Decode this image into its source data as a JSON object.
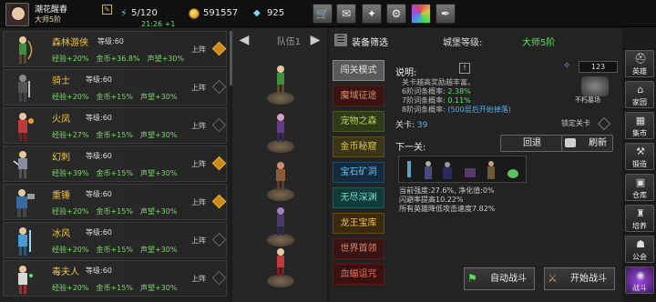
{
  "player": {
    "name": "潮花醒春",
    "rank": "大师5阶"
  },
  "resources": {
    "energy": "5/120",
    "energy_rate": "21:26 +1",
    "gold": "591557",
    "gems": "925"
  },
  "top_buttons": [
    "shop-icon",
    "mail-icon",
    "gamepad-icon",
    "settings-icon",
    "color-wheel-icon",
    "feather-icon"
  ],
  "heroes": [
    {
      "name": "森林游侠",
      "level": "等级:60",
      "exp": "经验+20%",
      "gold": "金币+36.8%",
      "rep": "声望+30%",
      "status": "上阵",
      "selected": true
    },
    {
      "name": "骑士",
      "level": "等级:60",
      "exp": "经验+20%",
      "gold": "金币+15%",
      "rep": "声望+30%",
      "status": "上阵",
      "selected": false
    },
    {
      "name": "火凤",
      "level": "等级:60",
      "exp": "经验+27%",
      "gold": "金币+15%",
      "rep": "声望+30%",
      "status": "上阵",
      "selected": false
    },
    {
      "name": "幻刺",
      "level": "等级:60",
      "exp": "经验+39%",
      "gold": "金币+15%",
      "rep": "声望+30%",
      "status": "上阵",
      "selected": true
    },
    {
      "name": "重锤",
      "level": "等级:60",
      "exp": "经验+20%",
      "gold": "金币+15%",
      "rep": "声望+30%",
      "status": "上阵",
      "selected": true
    },
    {
      "name": "冰风",
      "level": "等级:60",
      "exp": "经验+20%",
      "gold": "金币+15%",
      "rep": "声望+30%",
      "status": "上阵",
      "selected": false
    },
    {
      "name": "毒夫人",
      "level": "等级:60",
      "exp": "经验+20%",
      "gold": "金币+15%",
      "rep": "声望+30%",
      "status": "上阵",
      "selected": false
    }
  ],
  "team": {
    "label": "队伍1"
  },
  "main": {
    "title": "装备筛选",
    "fortress_label": "城堡等级:",
    "fortress_value": "大师5阶",
    "modes": [
      "闯关模式",
      "魔域征途",
      "宠物之森",
      "金币秘窟",
      "宝石矿洞",
      "无尽深渊",
      "龙王宝库",
      "世界首领",
      "血蝠诅咒"
    ],
    "desc_label": "说明:",
    "chest_count": "123",
    "stage_image_label": "不朽墓场",
    "desc_lines": {
      "l1": "关卡越高奖励越丰富。",
      "l2_label": "6阶词条概率:",
      "l2_value": "2.38%",
      "l3_label": "7阶词条概率:",
      "l3_value": "0.11%",
      "l4_label": "8阶词条概率:",
      "l4_value": "(500层后开始掉落)"
    },
    "stage_label": "关卡:",
    "stage_value": "39",
    "lock_label": "锁定关卡",
    "next_label": "下一关:",
    "back_button": "回退",
    "refresh_button": "刷新",
    "stats": {
      "s1": "当前强度:27.6%, 净化值:0%",
      "s2": "闪避率提高10.22%",
      "s3": "所有英雄降低攻击速度7.82%"
    },
    "auto_button": "自动战斗",
    "start_button": "开始战斗"
  },
  "nav": [
    {
      "label": "英雄",
      "icon": "helmet-icon"
    },
    {
      "label": "家园",
      "icon": "home-icon"
    },
    {
      "label": "集市",
      "icon": "market-icon"
    },
    {
      "label": "锻造",
      "icon": "anvil-icon"
    },
    {
      "label": "仓库",
      "icon": "warehouse-icon"
    },
    {
      "label": "培养",
      "icon": "training-icon"
    },
    {
      "label": "公会",
      "icon": "guild-icon"
    },
    {
      "label": "战斗",
      "icon": "battle-portal-icon"
    }
  ]
}
